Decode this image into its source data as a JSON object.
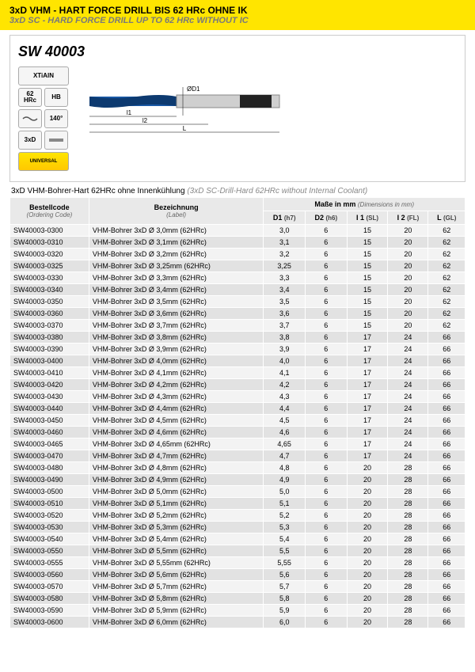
{
  "header": {
    "title_main": "3xD VHM - HART FORCE DRILL BIS 62 HRc OHNE IK",
    "title_sub": "3xD SC - HARD FORCE DRILL UP TO 62 HRc WITHOUT IC"
  },
  "hero": {
    "product_code": "SW 40003",
    "badges": {
      "coating": "XTiAlN",
      "hrc": "62\nHRc",
      "hb": "HB",
      "angle": "140°",
      "xd": "3xD",
      "universal": "UNIVERSAL"
    },
    "diagram_labels": {
      "d1": "ØD1",
      "l1": "l1",
      "l2": "l2",
      "L": "L"
    }
  },
  "subtitle": {
    "de": "3xD VHM-Bohrer-Hart 62HRc ohne Innenkühlung",
    "en": "(3xD SC-Drill-Hard 62HRc without Internal Coolant)"
  },
  "table": {
    "headers": {
      "code": "Bestellcode",
      "code_en": "(Ordering Code)",
      "label": "Bezeichnung",
      "label_en": "(Label)",
      "dims": "Maße in mm",
      "dims_en": "(Dimensions in mm)",
      "d1": "D1",
      "d1s": "(h7)",
      "d2": "D2",
      "d2s": "(h6)",
      "i1": "I 1",
      "i1s": "(SL)",
      "i2": "I 2",
      "i2s": "(FL)",
      "L": "L",
      "Ls": "(GL)"
    },
    "rows": [
      {
        "code": "SW40003-0300",
        "label": "VHM-Bohrer 3xD Ø 3,0mm (62HRc)",
        "d1": "3,0",
        "d2": "6",
        "i1": "15",
        "i2": "20",
        "L": "62"
      },
      {
        "code": "SW40003-0310",
        "label": "VHM-Bohrer 3xD Ø 3,1mm (62HRc)",
        "d1": "3,1",
        "d2": "6",
        "i1": "15",
        "i2": "20",
        "L": "62"
      },
      {
        "code": "SW40003-0320",
        "label": "VHM-Bohrer 3xD Ø 3,2mm (62HRc)",
        "d1": "3,2",
        "d2": "6",
        "i1": "15",
        "i2": "20",
        "L": "62"
      },
      {
        "code": "SW40003-0325",
        "label": "VHM-Bohrer 3xD Ø 3,25mm (62HRc)",
        "d1": "3,25",
        "d2": "6",
        "i1": "15",
        "i2": "20",
        "L": "62"
      },
      {
        "code": "SW40003-0330",
        "label": "VHM-Bohrer 3xD Ø 3,3mm (62HRc)",
        "d1": "3,3",
        "d2": "6",
        "i1": "15",
        "i2": "20",
        "L": "62"
      },
      {
        "code": "SW40003-0340",
        "label": "VHM-Bohrer 3xD Ø 3,4mm (62HRc)",
        "d1": "3,4",
        "d2": "6",
        "i1": "15",
        "i2": "20",
        "L": "62"
      },
      {
        "code": "SW40003-0350",
        "label": "VHM-Bohrer 3xD Ø 3,5mm (62HRc)",
        "d1": "3,5",
        "d2": "6",
        "i1": "15",
        "i2": "20",
        "L": "62"
      },
      {
        "code": "SW40003-0360",
        "label": "VHM-Bohrer 3xD Ø 3,6mm (62HRc)",
        "d1": "3,6",
        "d2": "6",
        "i1": "15",
        "i2": "20",
        "L": "62"
      },
      {
        "code": "SW40003-0370",
        "label": "VHM-Bohrer 3xD Ø 3,7mm (62HRc)",
        "d1": "3,7",
        "d2": "6",
        "i1": "15",
        "i2": "20",
        "L": "62"
      },
      {
        "code": "SW40003-0380",
        "label": "VHM-Bohrer 3xD Ø 3,8mm (62HRc)",
        "d1": "3,8",
        "d2": "6",
        "i1": "17",
        "i2": "24",
        "L": "66"
      },
      {
        "code": "SW40003-0390",
        "label": "VHM-Bohrer 3xD Ø 3,9mm (62HRc)",
        "d1": "3,9",
        "d2": "6",
        "i1": "17",
        "i2": "24",
        "L": "66"
      },
      {
        "code": "SW40003-0400",
        "label": "VHM-Bohrer 3xD Ø 4,0mm (62HRc)",
        "d1": "4,0",
        "d2": "6",
        "i1": "17",
        "i2": "24",
        "L": "66"
      },
      {
        "code": "SW40003-0410",
        "label": "VHM-Bohrer 3xD Ø 4,1mm (62HRc)",
        "d1": "4,1",
        "d2": "6",
        "i1": "17",
        "i2": "24",
        "L": "66"
      },
      {
        "code": "SW40003-0420",
        "label": "VHM-Bohrer 3xD Ø 4,2mm (62HRc)",
        "d1": "4,2",
        "d2": "6",
        "i1": "17",
        "i2": "24",
        "L": "66"
      },
      {
        "code": "SW40003-0430",
        "label": "VHM-Bohrer 3xD Ø 4,3mm (62HRc)",
        "d1": "4,3",
        "d2": "6",
        "i1": "17",
        "i2": "24",
        "L": "66"
      },
      {
        "code": "SW40003-0440",
        "label": "VHM-Bohrer 3xD Ø 4,4mm (62HRc)",
        "d1": "4,4",
        "d2": "6",
        "i1": "17",
        "i2": "24",
        "L": "66"
      },
      {
        "code": "SW40003-0450",
        "label": "VHM-Bohrer 3xD Ø 4,5mm (62HRc)",
        "d1": "4,5",
        "d2": "6",
        "i1": "17",
        "i2": "24",
        "L": "66"
      },
      {
        "code": "SW40003-0460",
        "label": "VHM-Bohrer 3xD Ø 4,6mm (62HRc)",
        "d1": "4,6",
        "d2": "6",
        "i1": "17",
        "i2": "24",
        "L": "66"
      },
      {
        "code": "SW40003-0465",
        "label": "VHM-Bohrer 3xD Ø 4,65mm (62HRc)",
        "d1": "4,65",
        "d2": "6",
        "i1": "17",
        "i2": "24",
        "L": "66"
      },
      {
        "code": "SW40003-0470",
        "label": "VHM-Bohrer 3xD Ø 4,7mm (62HRc)",
        "d1": "4,7",
        "d2": "6",
        "i1": "17",
        "i2": "24",
        "L": "66"
      },
      {
        "code": "SW40003-0480",
        "label": "VHM-Bohrer 3xD Ø 4,8mm (62HRc)",
        "d1": "4,8",
        "d2": "6",
        "i1": "20",
        "i2": "28",
        "L": "66"
      },
      {
        "code": "SW40003-0490",
        "label": "VHM-Bohrer 3xD Ø 4,9mm (62HRc)",
        "d1": "4,9",
        "d2": "6",
        "i1": "20",
        "i2": "28",
        "L": "66"
      },
      {
        "code": "SW40003-0500",
        "label": "VHM-Bohrer 3xD Ø 5,0mm (62HRc)",
        "d1": "5,0",
        "d2": "6",
        "i1": "20",
        "i2": "28",
        "L": "66"
      },
      {
        "code": "SW40003-0510",
        "label": "VHM-Bohrer 3xD Ø 5,1mm (62HRc)",
        "d1": "5,1",
        "d2": "6",
        "i1": "20",
        "i2": "28",
        "L": "66"
      },
      {
        "code": "SW40003-0520",
        "label": "VHM-Bohrer 3xD Ø 5,2mm (62HRc)",
        "d1": "5,2",
        "d2": "6",
        "i1": "20",
        "i2": "28",
        "L": "66"
      },
      {
        "code": "SW40003-0530",
        "label": "VHM-Bohrer 3xD Ø 5,3mm (62HRc)",
        "d1": "5,3",
        "d2": "6",
        "i1": "20",
        "i2": "28",
        "L": "66"
      },
      {
        "code": "SW40003-0540",
        "label": "VHM-Bohrer 3xD Ø 5,4mm (62HRc)",
        "d1": "5,4",
        "d2": "6",
        "i1": "20",
        "i2": "28",
        "L": "66"
      },
      {
        "code": "SW40003-0550",
        "label": "VHM-Bohrer 3xD Ø 5,5mm (62HRc)",
        "d1": "5,5",
        "d2": "6",
        "i1": "20",
        "i2": "28",
        "L": "66"
      },
      {
        "code": "SW40003-0555",
        "label": "VHM-Bohrer 3xD Ø 5,55mm (62HRc)",
        "d1": "5,55",
        "d2": "6",
        "i1": "20",
        "i2": "28",
        "L": "66"
      },
      {
        "code": "SW40003-0560",
        "label": "VHM-Bohrer 3xD Ø 5,6mm (62HRc)",
        "d1": "5,6",
        "d2": "6",
        "i1": "20",
        "i2": "28",
        "L": "66"
      },
      {
        "code": "SW40003-0570",
        "label": "VHM-Bohrer 3xD Ø 5,7mm (62HRc)",
        "d1": "5,7",
        "d2": "6",
        "i1": "20",
        "i2": "28",
        "L": "66"
      },
      {
        "code": "SW40003-0580",
        "label": "VHM-Bohrer 3xD Ø 5,8mm (62HRc)",
        "d1": "5,8",
        "d2": "6",
        "i1": "20",
        "i2": "28",
        "L": "66"
      },
      {
        "code": "SW40003-0590",
        "label": "VHM-Bohrer 3xD Ø 5,9mm (62HRc)",
        "d1": "5,9",
        "d2": "6",
        "i1": "20",
        "i2": "28",
        "L": "66"
      },
      {
        "code": "SW40003-0600",
        "label": "VHM-Bohrer 3xD Ø 6,0mm (62HRc)",
        "d1": "6,0",
        "d2": "6",
        "i1": "20",
        "i2": "28",
        "L": "66"
      }
    ]
  }
}
